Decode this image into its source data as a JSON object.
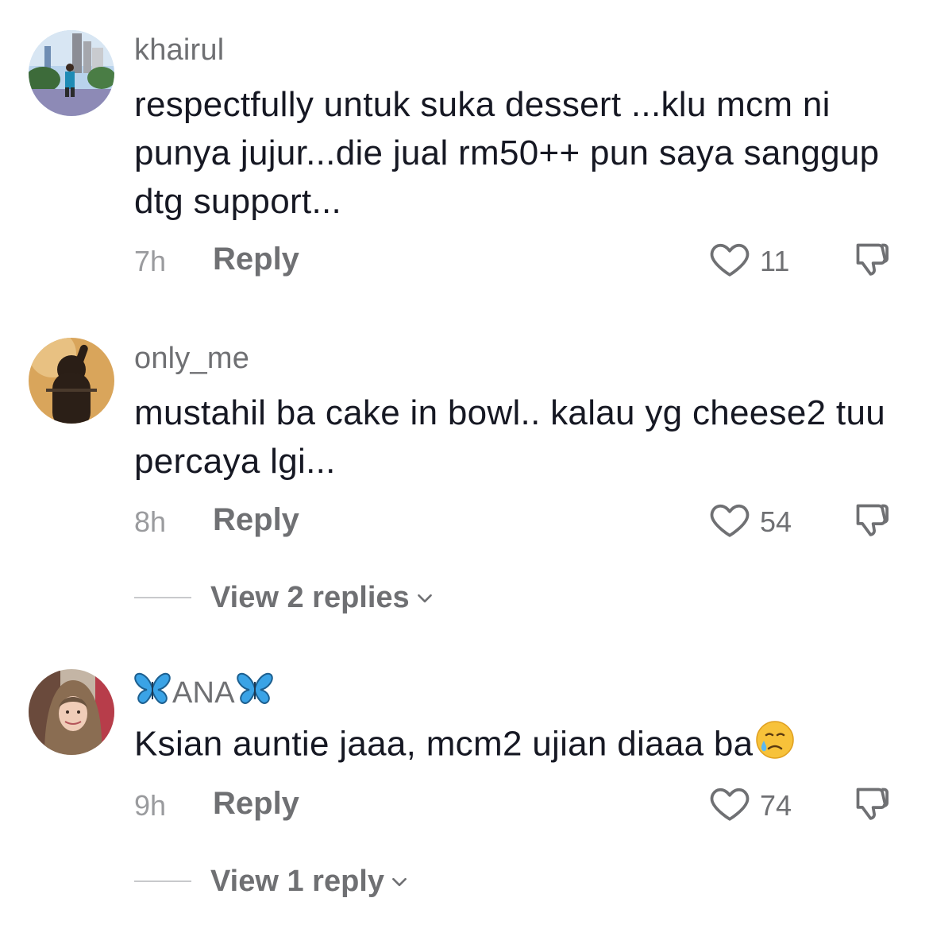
{
  "comments": [
    {
      "username": "khairul",
      "text": "respectfully untuk suka dessert ...klu mcm ni punya jujur...die jual rm50++ pun saya sanggup dtg support...",
      "time": "7h",
      "reply_label": "Reply",
      "likes": "11"
    },
    {
      "username": "only_me",
      "text": "mustahil ba cake in bowl.. kalau yg cheese2 tuu percaya lgi...",
      "time": "8h",
      "reply_label": "Reply",
      "likes": "54",
      "view_replies": "View 2 replies"
    },
    {
      "username": "ANA",
      "text": "Ksian auntie jaaa, mcm2 ujian diaaa ba",
      "time": "9h",
      "reply_label": "Reply",
      "likes": "74",
      "view_replies": "View 1 reply"
    }
  ],
  "icons": {
    "like": "heart-outline-icon",
    "dislike": "thumbs-down-icon",
    "username_decoration": "butterfly-emoji",
    "text_emoji": "crying-face-emoji"
  },
  "colors": {
    "text": "#161823",
    "secondary": "#6f7073",
    "muted": "#9a9b9e",
    "butterfly": "#3aa3e6"
  }
}
